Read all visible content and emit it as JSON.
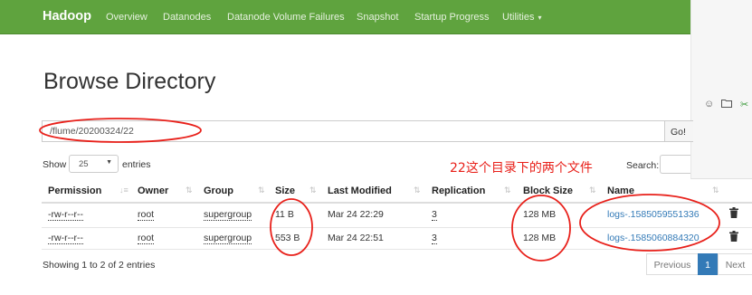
{
  "navbar": {
    "brand": "Hadoop",
    "links": [
      "Overview",
      "Datanodes",
      "Datanode Volume Failures",
      "Snapshot",
      "Startup Progress",
      "Utilities"
    ],
    "background": "#5fa33e"
  },
  "side_panel": {
    "icons": [
      "smiley-icon",
      "folder-icon",
      "scissors-icon"
    ]
  },
  "page": {
    "title": "Browse Directory"
  },
  "path": {
    "value": "/flume/20200324/22",
    "go_label": "Go!"
  },
  "controls": {
    "show_label": "Show",
    "length_value": "25",
    "entries_label": "entries",
    "search_label": "Search:"
  },
  "annotation": {
    "text": "22这个目录下的两个文件",
    "color": "#e8201a"
  },
  "table": {
    "columns": [
      "Permission",
      "Owner",
      "Group",
      "Size",
      "Last Modified",
      "Replication",
      "Block Size",
      "Name"
    ],
    "rows": [
      {
        "permission": "-rw-r--r--",
        "owner": "root",
        "group": "supergroup",
        "size": "11 B",
        "modified": "Mar 24 22:29",
        "replication": "3",
        "block_size": "128 MB",
        "name": "logs-.1585059551336"
      },
      {
        "permission": "-rw-r--r--",
        "owner": "root",
        "group": "supergroup",
        "size": "553 B",
        "modified": "Mar 24 22:51",
        "replication": "3",
        "block_size": "128 MB",
        "name": "logs-.1585060884320"
      }
    ]
  },
  "footer": {
    "info": "Showing 1 to 2 of 2 entries",
    "pager": {
      "previous": "Previous",
      "current": "1",
      "next": "Next"
    },
    "accent": "#337ab7"
  }
}
